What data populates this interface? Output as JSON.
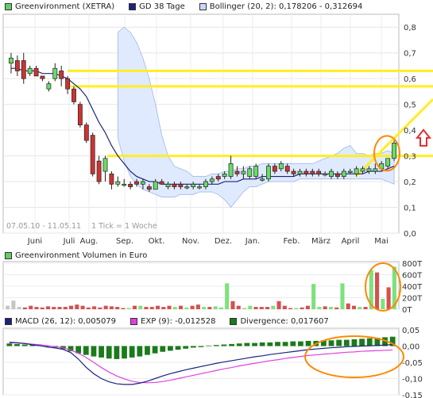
{
  "price_panel": {
    "legend": [
      {
        "label": "Greenvironment (XETRA)",
        "color": "#66cc66",
        "icon": "green-square-icon"
      },
      {
        "label": "GD 38 Tage",
        "color": "#1a237e",
        "icon": "navy-square-icon"
      },
      {
        "label": "Bollinger (20, 2): 0,178206 - 0,312694",
        "color": "#c8d8ff",
        "icon": "lightblue-square-icon"
      }
    ],
    "period_note": "07.05.10 - 11.05.11",
    "tick_note": "1 Tick = 1 Woche",
    "y_ticks": [
      "0,8",
      "0,7",
      "0,6",
      "0,5",
      "0,4",
      "0,3",
      "0,2",
      "0,1",
      "0,0"
    ],
    "x_ticks": [
      "Juni",
      "Juli",
      "Aug.",
      "Sep.",
      "Okt.",
      "Nov.",
      "Dez.",
      "Jan.",
      "Feb.",
      "März",
      "April",
      "Mai"
    ]
  },
  "volume_panel": {
    "legend": [
      {
        "label": "Greenvironment Volumen in Euro",
        "color": "#66cc66",
        "icon": "green-square-icon"
      }
    ],
    "y_ticks": [
      "800T",
      "600T",
      "400T",
      "200T",
      "0T"
    ]
  },
  "macd_panel": {
    "legend": [
      {
        "label": "MACD (26, 12): 0,005079",
        "color": "#1a237e",
        "icon": "navy-square-icon"
      },
      {
        "label": "EXP (9): -0,012528",
        "color": "#e040e0",
        "icon": "magenta-square-icon"
      },
      {
        "label": "Divergence: 0,017607",
        "color": "#1b7a1b",
        "icon": "darkgreen-square-icon"
      }
    ],
    "y_ticks": [
      "0,05",
      "0,00",
      "-0,05",
      "-0,10",
      "-0,15"
    ]
  },
  "colors": {
    "up": "#66dd66",
    "down": "#cc3333",
    "ma": "#1a237e",
    "band": "#dde8ff",
    "highlight": "#ffee22",
    "annotation": "#ff8800",
    "arrow": "#e03030",
    "exp": "#e040e0",
    "divergence": "#1b7a1b"
  },
  "chart_data": [
    {
      "type": "candlestick",
      "title": "Greenvironment (XETRA)",
      "ylim": [
        0,
        0.85
      ],
      "x_ticks": [
        "Juni",
        "Juli",
        "Aug.",
        "Sep.",
        "Okt.",
        "Nov.",
        "Dez.",
        "Jan.",
        "Feb.",
        "März",
        "April",
        "Mai"
      ],
      "candles": [
        [
          0.66,
          0.7,
          0.62,
          0.68
        ],
        [
          0.67,
          0.69,
          0.61,
          0.63
        ],
        [
          0.67,
          0.7,
          0.58,
          0.6
        ],
        [
          0.62,
          0.65,
          0.61,
          0.64
        ],
        [
          0.64,
          0.65,
          0.61,
          0.61
        ],
        [
          0.61,
          0.61,
          0.59,
          0.6
        ],
        [
          0.56,
          0.59,
          0.55,
          0.58
        ],
        [
          0.6,
          0.66,
          0.59,
          0.64
        ],
        [
          0.63,
          0.65,
          0.57,
          0.6
        ],
        [
          0.6,
          0.61,
          0.54,
          0.56
        ],
        [
          0.56,
          0.57,
          0.5,
          0.51
        ],
        [
          0.5,
          0.51,
          0.41,
          0.42
        ],
        [
          0.42,
          0.43,
          0.35,
          0.36
        ],
        [
          0.38,
          0.39,
          0.22,
          0.23
        ],
        [
          0.28,
          0.3,
          0.19,
          0.2
        ],
        [
          0.24,
          0.3,
          0.2,
          0.29
        ],
        [
          0.23,
          0.24,
          0.17,
          0.19
        ],
        [
          0.19,
          0.22,
          0.18,
          0.2
        ],
        [
          0.19,
          0.21,
          0.18,
          0.19
        ],
        [
          0.19,
          0.2,
          0.17,
          0.18
        ],
        [
          0.2,
          0.21,
          0.18,
          0.19
        ],
        [
          0.19,
          0.21,
          0.17,
          0.2
        ],
        [
          0.18,
          0.19,
          0.16,
          0.17
        ],
        [
          0.17,
          0.21,
          0.17,
          0.2
        ],
        [
          0.2,
          0.21,
          0.19,
          0.19
        ],
        [
          0.18,
          0.2,
          0.17,
          0.19
        ],
        [
          0.19,
          0.2,
          0.17,
          0.18
        ],
        [
          0.19,
          0.2,
          0.17,
          0.18
        ],
        [
          0.18,
          0.19,
          0.17,
          0.18
        ],
        [
          0.18,
          0.2,
          0.17,
          0.19
        ],
        [
          0.18,
          0.19,
          0.17,
          0.18
        ],
        [
          0.18,
          0.21,
          0.17,
          0.2
        ],
        [
          0.2,
          0.22,
          0.19,
          0.21
        ],
        [
          0.22,
          0.23,
          0.2,
          0.21
        ],
        [
          0.22,
          0.24,
          0.21,
          0.23
        ],
        [
          0.22,
          0.3,
          0.21,
          0.27
        ],
        [
          0.24,
          0.26,
          0.22,
          0.23
        ],
        [
          0.23,
          0.26,
          0.21,
          0.24
        ],
        [
          0.22,
          0.26,
          0.21,
          0.25
        ],
        [
          0.22,
          0.27,
          0.21,
          0.26
        ],
        [
          0.21,
          0.23,
          0.2,
          0.21
        ],
        [
          0.21,
          0.27,
          0.2,
          0.26
        ],
        [
          0.26,
          0.27,
          0.23,
          0.24
        ],
        [
          0.25,
          0.28,
          0.24,
          0.27
        ],
        [
          0.26,
          0.27,
          0.23,
          0.24
        ],
        [
          0.24,
          0.25,
          0.22,
          0.23
        ],
        [
          0.23,
          0.25,
          0.22,
          0.24
        ],
        [
          0.24,
          0.25,
          0.22,
          0.23
        ],
        [
          0.24,
          0.25,
          0.22,
          0.23
        ],
        [
          0.24,
          0.25,
          0.22,
          0.23
        ],
        [
          0.23,
          0.24,
          0.22,
          0.23
        ],
        [
          0.22,
          0.25,
          0.21,
          0.24
        ],
        [
          0.23,
          0.24,
          0.21,
          0.22
        ],
        [
          0.22,
          0.25,
          0.21,
          0.24
        ],
        [
          0.24,
          0.25,
          0.23,
          0.24
        ],
        [
          0.23,
          0.26,
          0.22,
          0.25
        ],
        [
          0.24,
          0.26,
          0.23,
          0.25
        ],
        [
          0.24,
          0.26,
          0.23,
          0.25
        ],
        [
          0.24,
          0.27,
          0.23,
          0.25
        ],
        [
          0.25,
          0.28,
          0.24,
          0.27
        ],
        [
          0.26,
          0.29,
          0.25,
          0.29
        ],
        [
          0.29,
          0.36,
          0.28,
          0.35
        ]
      ],
      "ma38": [
        0.64,
        0.64,
        0.63,
        0.63,
        0.63,
        0.62,
        0.62,
        0.62,
        0.61,
        0.6,
        0.58,
        0.56,
        0.53,
        0.48,
        0.43,
        0.39,
        0.34,
        0.3,
        0.27,
        0.24,
        0.22,
        0.21,
        0.2,
        0.2,
        0.19,
        0.19,
        0.19,
        0.19,
        0.19,
        0.19,
        0.19,
        0.19,
        0.19,
        0.19,
        0.2,
        0.2,
        0.2,
        0.21,
        0.21,
        0.21,
        0.22,
        0.22,
        0.22,
        0.22,
        0.22,
        0.22,
        0.23,
        0.23,
        0.23,
        0.23,
        0.23,
        0.23,
        0.23,
        0.23,
        0.23,
        0.23,
        0.23,
        0.24,
        0.24,
        0.24,
        0.25,
        0.26
      ],
      "bollinger_start": 17,
      "bollinger_upper": [
        0.78,
        0.8,
        0.78,
        0.74,
        0.68,
        0.6,
        0.5,
        0.38,
        0.3,
        0.26,
        0.25,
        0.24,
        0.22,
        0.22,
        0.22,
        0.23,
        0.23,
        0.24,
        0.24,
        0.25,
        0.25,
        0.26,
        0.26,
        0.27,
        0.27,
        0.27,
        0.27,
        0.27,
        0.27,
        0.27,
        0.27,
        0.27,
        0.28,
        0.29,
        0.3,
        0.31,
        0.33,
        0.34,
        0.31,
        0.31,
        0.3,
        0.31,
        0.31,
        0.32,
        0.31
      ],
      "bollinger_lower": [
        0.37,
        0.28,
        0.22,
        0.19,
        0.17,
        0.16,
        0.15,
        0.14,
        0.14,
        0.14,
        0.15,
        0.15,
        0.15,
        0.16,
        0.16,
        0.16,
        0.15,
        0.13,
        0.1,
        0.13,
        0.16,
        0.18,
        0.18,
        0.19,
        0.2,
        0.2,
        0.2,
        0.2,
        0.2,
        0.21,
        0.21,
        0.21,
        0.21,
        0.21,
        0.21,
        0.21,
        0.21,
        0.21,
        0.21,
        0.21,
        0.21,
        0.21,
        0.21,
        0.2,
        0.19
      ]
    },
    {
      "type": "bar",
      "title": "Greenvironment Volumen in Euro",
      "ylim": [
        0,
        800
      ],
      "units": "T",
      "values": [
        60,
        150,
        40,
        30,
        60,
        40,
        30,
        50,
        40,
        40,
        40,
        60,
        80,
        60,
        30,
        50,
        30,
        60,
        50,
        40,
        20,
        20,
        60,
        60,
        40,
        40,
        60,
        40,
        60,
        40,
        60,
        30,
        60,
        80,
        40,
        40,
        50,
        30,
        450,
        140,
        60,
        20,
        60,
        40,
        40,
        40,
        60,
        140,
        60,
        20,
        20,
        30,
        60,
        440,
        40,
        50,
        40,
        30,
        450,
        100,
        60,
        40,
        40,
        680,
        640,
        180,
        380,
        740
      ],
      "up": [
        0,
        0,
        0,
        0,
        0,
        0,
        0,
        0,
        0,
        0,
        0,
        0,
        0,
        0,
        0,
        0,
        0,
        0,
        0,
        0,
        0,
        1,
        0,
        1,
        0,
        0,
        0,
        0,
        0,
        1,
        0,
        1,
        0,
        0,
        1,
        0,
        1,
        1,
        1,
        0,
        0,
        1,
        1,
        0,
        0,
        0,
        1,
        0,
        0,
        0,
        1,
        0,
        0,
        1,
        1,
        0,
        1,
        0,
        1,
        0,
        0,
        1,
        0,
        1,
        0,
        1,
        0,
        1
      ],
      "highlight_gray": [
        0,
        1,
        2
      ]
    },
    {
      "type": "line",
      "title": "MACD (26, 12)",
      "ylim": [
        -0.15,
        0.05
      ],
      "series": [
        {
          "name": "MACD (26, 12)",
          "values": [
            0.012,
            0.01,
            0.008,
            0.004,
            0.001,
            -0.003,
            -0.006,
            -0.01,
            -0.02,
            -0.04,
            -0.065,
            -0.085,
            -0.1,
            -0.11,
            -0.116,
            -0.118,
            -0.118,
            -0.114,
            -0.108,
            -0.1,
            -0.092,
            -0.085,
            -0.079,
            -0.073,
            -0.068,
            -0.063,
            -0.058,
            -0.053,
            -0.049,
            -0.045,
            -0.041,
            -0.037,
            -0.033,
            -0.03,
            -0.026,
            -0.023,
            -0.02,
            -0.017,
            -0.014,
            -0.011,
            -0.009,
            -0.007,
            -0.005,
            -0.004,
            -0.002,
            -0.001,
            0.0,
            0.001,
            0.002,
            0.003,
            0.005
          ]
        },
        {
          "name": "EXP (9)",
          "values": [
            0.01,
            0.01,
            0.008,
            0.006,
            0.004,
            0.001,
            -0.002,
            -0.006,
            -0.012,
            -0.022,
            -0.035,
            -0.05,
            -0.066,
            -0.08,
            -0.092,
            -0.101,
            -0.108,
            -0.112,
            -0.113,
            -0.112,
            -0.109,
            -0.105,
            -0.1,
            -0.095,
            -0.09,
            -0.085,
            -0.08,
            -0.075,
            -0.07,
            -0.066,
            -0.061,
            -0.057,
            -0.053,
            -0.049,
            -0.045,
            -0.042,
            -0.038,
            -0.035,
            -0.032,
            -0.029,
            -0.027,
            -0.025,
            -0.023,
            -0.021,
            -0.019,
            -0.018,
            -0.016,
            -0.015,
            -0.014,
            -0.013,
            -0.012
          ]
        },
        {
          "name": "Divergence",
          "values": [
            0.005,
            0.004,
            0.003,
            0.002,
            0.001,
            -0.001,
            -0.003,
            -0.006,
            -0.01,
            -0.014,
            -0.017,
            -0.02,
            -0.022,
            -0.024,
            -0.025,
            -0.024,
            -0.022,
            -0.02,
            -0.017,
            -0.014,
            -0.011,
            -0.009,
            -0.007,
            -0.005,
            -0.003,
            -0.002,
            0.001,
            0.002,
            0.003,
            0.004,
            0.005,
            0.006,
            0.006,
            0.007,
            0.007,
            0.008,
            0.008,
            0.009,
            0.009,
            0.01,
            0.01,
            0.011,
            0.011,
            0.012,
            0.012,
            0.013,
            0.014,
            0.015,
            0.016,
            0.017,
            0.018
          ]
        }
      ]
    }
  ]
}
